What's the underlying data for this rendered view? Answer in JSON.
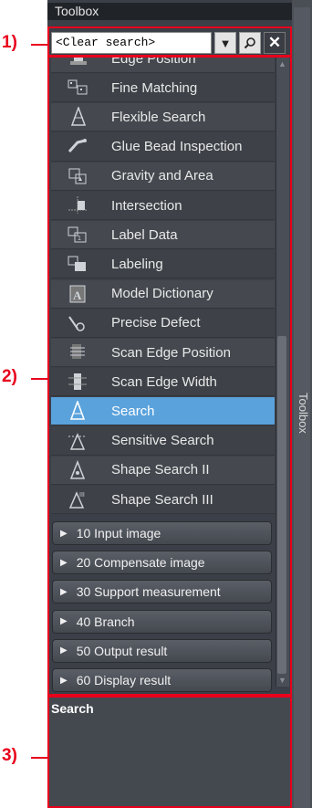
{
  "panel": {
    "title": "Toolbox",
    "side_tab": "Toolbox"
  },
  "callouts": [
    "1)",
    "2)",
    "3)"
  ],
  "search": {
    "value": "<Clear search>"
  },
  "items": [
    {
      "label": "Edge Position",
      "icon": "edge-position-icon"
    },
    {
      "label": "Fine Matching",
      "icon": "fine-matching-icon"
    },
    {
      "label": "Flexible Search",
      "icon": "flexible-search-icon"
    },
    {
      "label": "Glue Bead Inspection",
      "icon": "glue-bead-icon"
    },
    {
      "label": "Gravity and Area",
      "icon": "gravity-area-icon"
    },
    {
      "label": "Intersection",
      "icon": "intersection-icon"
    },
    {
      "label": "Label Data",
      "icon": "label-data-icon"
    },
    {
      "label": "Labeling",
      "icon": "labeling-icon"
    },
    {
      "label": "Model Dictionary",
      "icon": "model-dictionary-icon"
    },
    {
      "label": "Precise Defect",
      "icon": "precise-defect-icon"
    },
    {
      "label": "Scan Edge Position",
      "icon": "scan-edge-position-icon"
    },
    {
      "label": "Scan Edge Width",
      "icon": "scan-edge-width-icon"
    },
    {
      "label": "Search",
      "icon": "search-tool-icon",
      "selected": true
    },
    {
      "label": "Sensitive Search",
      "icon": "sensitive-search-icon"
    },
    {
      "label": "Shape Search II",
      "icon": "shape-search-2-icon"
    },
    {
      "label": "Shape Search III",
      "icon": "shape-search-3-icon"
    }
  ],
  "categories": [
    "10 Input image",
    "20 Compensate image",
    "30 Support measurement",
    "40 Branch",
    "50 Output result",
    "60 Display result"
  ],
  "description": {
    "title": "Search"
  },
  "colors": {
    "selected": "#5aa2dc",
    "callout": "#e8001c",
    "panel_bg": "#3b3f47"
  }
}
